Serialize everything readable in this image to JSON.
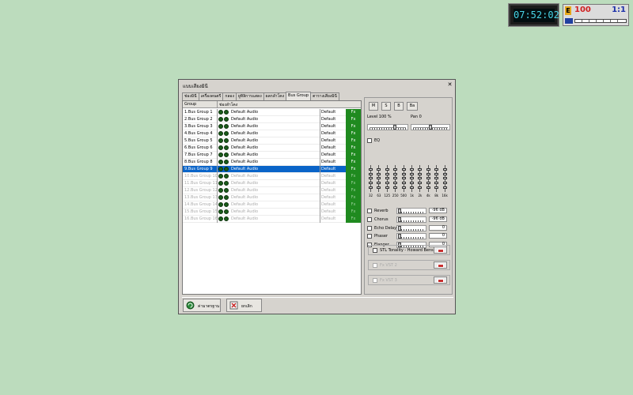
{
  "clock": {
    "time": "07:52:02"
  },
  "counter": {
    "badge": "E",
    "left_value": "100",
    "right_value": "1:1"
  },
  "window": {
    "title": "แบบเสียงมินี",
    "close_label": "✕",
    "tabs": [
      "ช่องมินี",
      "เครื่องดนตรี",
      "กลอง",
      "ยูทิลิการแสดง",
      "ผลกลำโคง",
      "Bus Group",
      "ตารางเสียงมินี"
    ],
    "active_tab": 5
  },
  "grid": {
    "headers": {
      "group": "Group",
      "device": "ช่องลำโคง"
    },
    "rows": [
      {
        "name": "1.Bus Group 1",
        "device": "Default Audio",
        "mode": "Default",
        "fx": "Fx",
        "state": "normal"
      },
      {
        "name": "2.Bus Group 2",
        "device": "Default Audio",
        "mode": "Default",
        "fx": "Fx",
        "state": "normal"
      },
      {
        "name": "3.Bus Group 3",
        "device": "Default Audio",
        "mode": "Default",
        "fx": "Fx",
        "state": "normal"
      },
      {
        "name": "4.Bus Group 4",
        "device": "Default Audio",
        "mode": "Default",
        "fx": "Fx",
        "state": "normal"
      },
      {
        "name": "5.Bus Group 5",
        "device": "Default Audio",
        "mode": "Default",
        "fx": "Fx",
        "state": "normal"
      },
      {
        "name": "6.Bus Group 6",
        "device": "Default Audio",
        "mode": "Default",
        "fx": "Fx",
        "state": "normal"
      },
      {
        "name": "7.Bus Group 7",
        "device": "Default Audio",
        "mode": "Default",
        "fx": "Fx",
        "state": "normal"
      },
      {
        "name": "8.Bus Group 8",
        "device": "Default Audio",
        "mode": "Default",
        "fx": "Fx",
        "state": "normal"
      },
      {
        "name": "9.Bus Group 9",
        "device": "Default Audio",
        "mode": "Default",
        "fx": "Fx",
        "state": "selected"
      },
      {
        "name": "10.Bus Group 10",
        "device": "Default Audio",
        "mode": "Default",
        "fx": "Fx",
        "state": "dim"
      },
      {
        "name": "11.Bus Group 11",
        "device": "Default Audio",
        "mode": "Default",
        "fx": "Fx",
        "state": "dim"
      },
      {
        "name": "12.Bus Group 12",
        "device": "Default Audio",
        "mode": "Default",
        "fx": "Fx",
        "state": "dim"
      },
      {
        "name": "13.Bus Group 13",
        "device": "Default Audio",
        "mode": "Default",
        "fx": "Fx",
        "state": "dim"
      },
      {
        "name": "14.Bus Group 14",
        "device": "Default Audio",
        "mode": "Default",
        "fx": "Fx",
        "state": "dim"
      },
      {
        "name": "15.Bus Group 15",
        "device": "Default Audio",
        "mode": "Default",
        "fx": "Fx",
        "state": "dim"
      },
      {
        "name": "16.Bus Group 16",
        "device": "Default Audio",
        "mode": "Default",
        "fx": "Fx",
        "state": "dim"
      }
    ]
  },
  "panel": {
    "buttons": [
      "M",
      "S",
      "B",
      "Ba"
    ],
    "level_label": "Level 100 %",
    "pan_label": "Pan 0",
    "level_fraction": 0.7,
    "pan_fraction": 0.5,
    "eq_label": "EQ",
    "eq_bands": [
      "32",
      "63",
      "125",
      "250",
      "500",
      "1k",
      "2k",
      "4k",
      "8k",
      "16k"
    ],
    "effects": [
      {
        "name": "Reverb",
        "value": "-96 dB"
      },
      {
        "name": "Chorus",
        "value": "-96 dB"
      },
      {
        "name": "Echo Delay",
        "value": "0"
      },
      {
        "name": "Phaser",
        "value": "0"
      },
      {
        "name": "Flanger",
        "value": "0"
      }
    ],
    "plugins": [
      {
        "name": "STL Tonality - Howard Benso",
        "enabled": true
      },
      {
        "name": "Fx VST 2",
        "enabled": false
      },
      {
        "name": "Fx VST 3",
        "enabled": false
      }
    ]
  },
  "bottom": {
    "default_label": "ค่ามาตรฐาน",
    "cancel_label": "ยกเลิก"
  }
}
